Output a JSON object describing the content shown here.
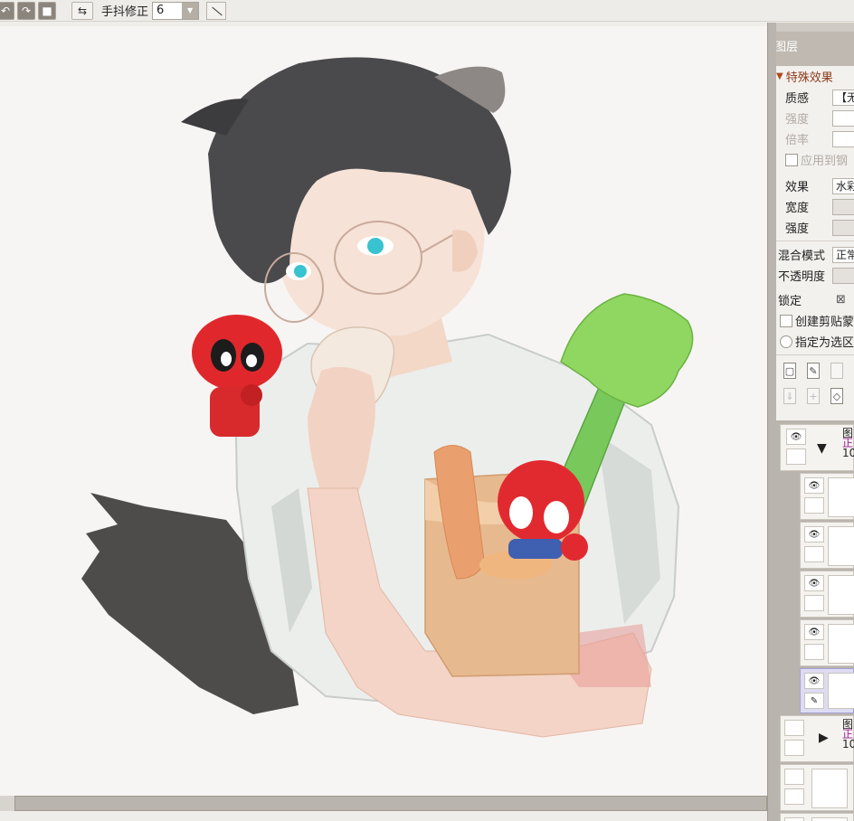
{
  "toolbar": {
    "stabilizer_label": "手抖修正",
    "stabilizer_value": "6"
  },
  "panel": {
    "title": "图层",
    "special_effects_header": "特殊效果",
    "texture_label": "质感",
    "texture_value": "【无",
    "strength_label": "强度",
    "scale_label": "倍率",
    "apply_label": "应用到钢",
    "effect_label": "效果",
    "effect_value": "水彩",
    "width_label": "宽度",
    "strength2_label": "强度",
    "blend_mode_label": "混合模式",
    "blend_mode_value": "正常",
    "opacity_label": "不透明度",
    "lock_label": "锁定",
    "lock_symbol": "⊠",
    "clipping_label": "创建剪贴蒙",
    "selection_label": "指定为选区"
  },
  "layers": [
    {
      "name": "图",
      "mode": "正",
      "opacity": "10"
    },
    {
      "name": "图",
      "mode": "正",
      "opacity": "10"
    }
  ]
}
